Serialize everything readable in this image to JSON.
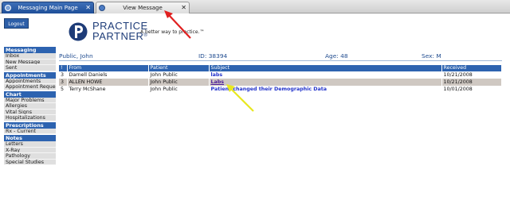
{
  "tabs": [
    {
      "label": "Messaging Main Page",
      "active": true
    },
    {
      "label": "View Message",
      "active": false
    }
  ],
  "logout_label": "Logout",
  "logo": {
    "line1": "PRACTICE",
    "line2": "PARTNER",
    "registered": "®",
    "tagline": "A better way to practice.™"
  },
  "sidebar": [
    {
      "header": "Messaging",
      "items": [
        "Inbox",
        "New Message",
        "Sent"
      ]
    },
    {
      "header": "Appointments",
      "items": [
        "Appointments",
        "Appointment Request"
      ]
    },
    {
      "header": "Chart",
      "items": [
        "Major Problems",
        "Allergies",
        "Vital Signs",
        "Hospitalizations"
      ]
    },
    {
      "header": "Prescriptions",
      "items": [
        "Rx - Current"
      ]
    },
    {
      "header": "Notes",
      "items": [
        "Letters",
        "X-Ray",
        "Pathology",
        "Special Studies"
      ]
    }
  ],
  "patient": {
    "name": "Public, John",
    "id": "ID: 38394",
    "age": "Age: 48",
    "sex": "Sex: M"
  },
  "table": {
    "columns": [
      "!",
      "From",
      "Patient",
      "Subject",
      "Received"
    ],
    "rows": [
      {
        "flag": "3",
        "from": "Darnell Daniels",
        "patient": "John Public",
        "subject": "labs",
        "received": "10/21/2008",
        "selected": false
      },
      {
        "flag": "3",
        "from": "ALLEN HOWE",
        "patient": "John Public",
        "subject": "Labs",
        "received": "10/21/2008",
        "selected": true
      },
      {
        "flag": "5",
        "from": "Terry McShane",
        "patient": "John Public",
        "subject": "Patient changed their Demographic Data",
        "received": "10/01/2008",
        "selected": false
      }
    ]
  },
  "colors": {
    "accent": "#2d63b0",
    "logo": "#1e3c78",
    "tab_active": "#2a5ba6",
    "red_arrow": "#e02020",
    "yellow_arrow": "#e8e820"
  },
  "icons": {
    "tab": "document-icon",
    "close": "close-icon",
    "logo": "practice-partner-logo-icon"
  }
}
